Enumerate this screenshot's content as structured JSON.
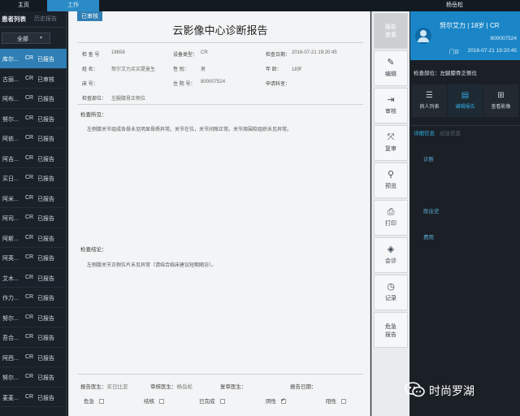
{
  "topbar": {
    "tab_main": "主页",
    "tab_work": "工作",
    "user": "杨岳松"
  },
  "left_panel": {
    "tab_patients": "患者列表",
    "tab_history": "历史报告",
    "filter": "全部",
    "rows": [
      {
        "name": "库尔...",
        "modality": "CR",
        "status": "已报告"
      },
      {
        "name": "古丽...",
        "modality": "CR",
        "status": "已审核"
      },
      {
        "name": "阿布...",
        "modality": "CR",
        "status": "已报告"
      },
      {
        "name": "努尔...",
        "modality": "CR",
        "status": "已报告"
      },
      {
        "name": "阿依...",
        "modality": "CR",
        "status": "已报告"
      },
      {
        "name": "阿吉...",
        "modality": "CR",
        "status": "已报告"
      },
      {
        "name": "买日...",
        "modality": "CR",
        "status": "已报告"
      },
      {
        "name": "阿米...",
        "modality": "CR",
        "status": "已报告"
      },
      {
        "name": "阿司...",
        "modality": "CR",
        "status": "已报告"
      },
      {
        "name": "阿斯...",
        "modality": "CR",
        "status": "已报告"
      },
      {
        "name": "阿英...",
        "modality": "CR",
        "status": "已报告"
      },
      {
        "name": "艾木...",
        "modality": "CR",
        "status": "已报告"
      },
      {
        "name": "作力...",
        "modality": "CR",
        "status": "已报告"
      },
      {
        "name": "努尔...",
        "modality": "CR",
        "status": "已报告"
      },
      {
        "name": "吾合...",
        "modality": "CR",
        "status": "已报告"
      },
      {
        "name": "阿西...",
        "modality": "CR",
        "status": "已报告"
      },
      {
        "name": "努尔...",
        "modality": "CR",
        "status": "已报告"
      },
      {
        "name": "麦麦...",
        "modality": "CR",
        "status": "已报告"
      }
    ]
  },
  "report": {
    "badge": "已审核",
    "title": "云影像中心诊断报告",
    "fields": {
      "exam_no_label": "检 查 号",
      "exam_no": "18658",
      "device_label": "设备类型：",
      "device": "CR",
      "exam_date_label": "检查日期：",
      "exam_date": "2016-07-21 19:20:45",
      "name_label": "姓      名：",
      "name": "努尔艾力买买提曼生",
      "sex_label": "性      别：",
      "sex": "男",
      "age_label": "年      龄：",
      "age": "18岁",
      "bed_label": "床      号：",
      "bed": "",
      "inpatient_label": "住 院 号：",
      "inpatient": "800007524",
      "dept_label": "申请科室：",
      "dept": "",
      "site_label": "检查部位：",
      "site": "左腿膝骨正侧位"
    },
    "findings_label": "检查所见：",
    "findings_text": "左侧膝关节组成各骨未见明显骨质异常。关节在位，关节间隙正常。关节周围软组织未见异常。",
    "conclusion_label": "检查结论：",
    "conclusion_text": "左侧膝关节正侧位片未见异常（请结合临床建议短期随访）。",
    "signatures": {
      "report_doctor_label": "报告医生：",
      "report_doctor": "买日比亚",
      "audit_doctor_label": "审核医生：",
      "audit_doctor": "杨岳松",
      "review_doctor_label": "复审医生：",
      "review_doctor": "",
      "report_date_label": "报告日期：",
      "report_date": ""
    },
    "checks": {
      "urgent": "危急",
      "nodule": "结核",
      "done": "已完成",
      "negative": "阴性",
      "positive": "阳性"
    }
  },
  "toolbar": {
    "report_top": "报告",
    "report_bottom": "查看",
    "edit": "编辑",
    "audit": "审核",
    "recheck": "复审",
    "preview": "预览",
    "print": "打印",
    "consult": "会诊",
    "record": "记录",
    "urgent_l1": "危急",
    "urgent_l2": "报告"
  },
  "right_panel": {
    "name": "努尔艾力 | 18岁 | CR",
    "patient_id": "800007524",
    "date_label": "门诊",
    "date": "2016-07-21 19:20:45",
    "exam_site": "检查部位：左腿膝骨正侧位",
    "tab_list": "病人列表",
    "tab_edit": "编辑报告",
    "tab_image": "查看影像",
    "detail_tab": "详细信息",
    "history_tab": "过往信息",
    "sec_diagnosis": "诊断",
    "sec_history": "既往史",
    "sec_drug": "费用"
  },
  "watermark": "时尚罗湖",
  "colors": {
    "accent": "#2f7fb5",
    "header_blue": "#1a86c7",
    "active_tab": "#2eaadf"
  }
}
